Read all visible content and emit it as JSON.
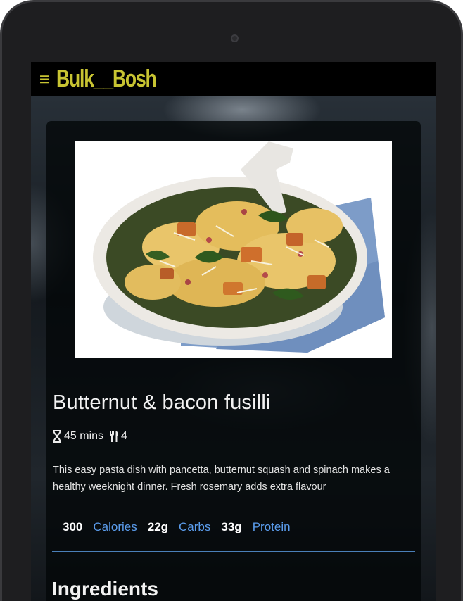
{
  "app": {
    "brand": "Bulk__Bosh",
    "menu_icon": "menu-icon"
  },
  "recipe": {
    "image_alt": "Butternut & bacon fusilli in a white pan",
    "title": "Butternut & bacon fusilli",
    "time": "45 mins",
    "servings": "4",
    "description": "This easy pasta dish with pancetta, butternut squash and spinach makes a healthy weeknight dinner. Fresh rosemary adds extra flavour",
    "nutrition": [
      {
        "value": "300",
        "label": "Calories"
      },
      {
        "value": "22g",
        "label": "Carbs"
      },
      {
        "value": "33g",
        "label": "Protein"
      }
    ],
    "ingredients_heading": "Ingredients"
  },
  "colors": {
    "brand": "#c8c432",
    "accent": "#5b9ded",
    "divider": "#4a7fb8"
  }
}
